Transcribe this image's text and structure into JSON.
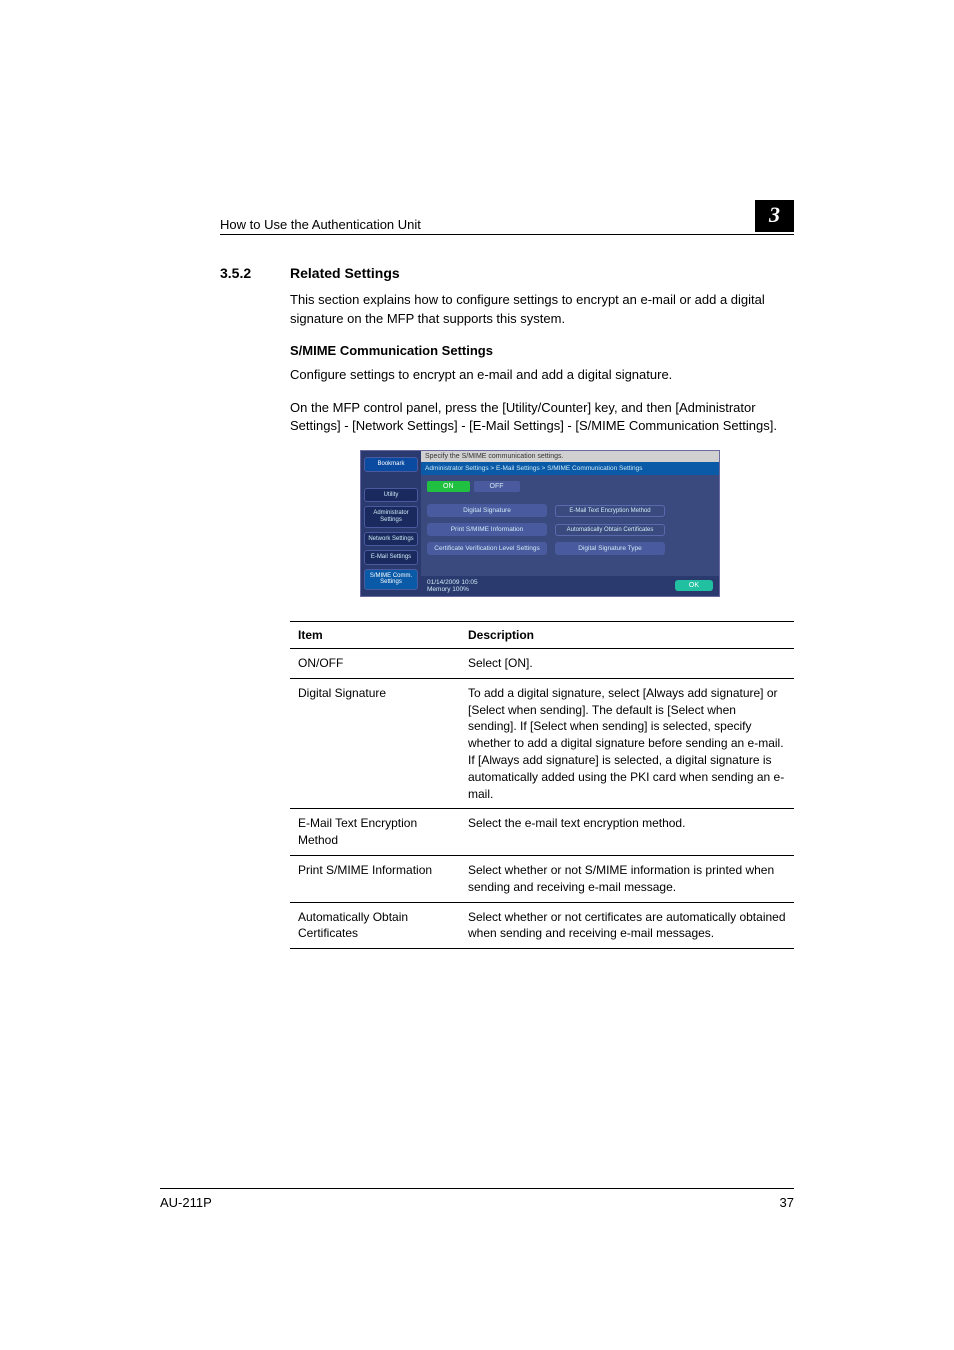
{
  "header": {
    "title": "How to Use the Authentication Unit",
    "chapter": "3"
  },
  "section": {
    "number": "3.5.2",
    "title": "Related Settings",
    "intro": "This section explains how to configure settings to encrypt an e-mail or add a digital signature on the MFP that supports this system."
  },
  "smime": {
    "heading": "S/MIME Communication Settings",
    "p1": "Configure settings to encrypt an e-mail and add a digital signature.",
    "p2": "On the MFP control panel, press the [Utility/Counter] key, and then [Administrator Settings] - [Network Settings] - [E-Mail Settings] - [S/MIME Communication Settings]."
  },
  "mfp": {
    "top": "Specify the S/MIME communication settings.",
    "breadcrumb": "Administrator Settings > E-Mail Settings > S/MIME Communication Settings",
    "tabs": {
      "bookmark": "Bookmark",
      "utility": "Utility",
      "admin": "Administrator Settings",
      "network": "Network Settings",
      "email": "E-Mail Settings",
      "smime": "S/MIME Comm. Settings"
    },
    "on": "ON",
    "off": "OFF",
    "buttons": {
      "digsig": "Digital Signature",
      "digsig_val": "E-Mail Text Encryption Method",
      "print": "Print S/MIME Information",
      "print_val": "Automatically Obtain Certificates",
      "cert": "Certificate Verification Level Settings",
      "sigtype": "Digital Signature Type"
    },
    "date": "01/14/2009  10:05",
    "memory": "Memory    100%",
    "ok": "OK"
  },
  "table": {
    "h1": "Item",
    "h2": "Description",
    "rows": [
      {
        "item": "ON/OFF",
        "desc": "Select [ON]."
      },
      {
        "item": "Digital Signature",
        "desc": "To add a digital signature, select [Always add signature] or [Select when sending]. The default is [Select when sending].\nIf [Select when sending] is selected, specify whether to add a digital signature before sending an e-mail.\nIf [Always add signature] is selected, a digital signature is automatically added using the PKI card when sending an e-mail."
      },
      {
        "item": "E-Mail Text Encryption Method",
        "desc": "Select the e-mail text encryption method."
      },
      {
        "item": "Print S/MIME Information",
        "desc": "Select whether or not S/MIME information is printed when sending and receiving e-mail message."
      },
      {
        "item": "Automatically Obtain Certificates",
        "desc": "Select whether or not certificates are automatically obtained when sending and receiving e-mail messages."
      }
    ]
  },
  "footer": {
    "model": "AU-211P",
    "page": "37"
  }
}
